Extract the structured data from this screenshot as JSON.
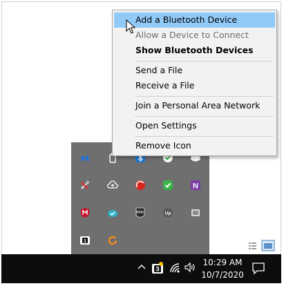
{
  "context_menu": {
    "items": [
      {
        "label": "Add a Bluetooth Device",
        "state": "highlighted"
      },
      {
        "label": "Allow a Device to Connect",
        "state": "disabled"
      },
      {
        "label": "Show Bluetooth Devices",
        "state": "default-bold"
      },
      {
        "label": "Send a File",
        "state": "normal"
      },
      {
        "label": "Receive a File",
        "state": "normal"
      },
      {
        "label": "Join a Personal Area Network",
        "state": "normal"
      },
      {
        "label": "Open Settings",
        "state": "normal"
      },
      {
        "label": "Remove Icon",
        "state": "normal"
      }
    ]
  },
  "tray_flyout": {
    "icons": [
      "malwarebytes-icon",
      "usb-drive-icon",
      "bluetooth-icon",
      "shield-check-icon",
      "cloud-icon",
      "tools-icon",
      "cloud-upload-icon",
      "antivirus-icon",
      "check-icon",
      "onenote-icon",
      "mcafee-icon",
      "cloud-check-icon",
      "epic-games-icon",
      "upwork-icon",
      "network-icon",
      "notification-badge-icon",
      "sync-icon"
    ],
    "badge_number": "1",
    "epic_text": "EPIC",
    "upwork_text": "Up",
    "onenote_letter": "N"
  },
  "taskbar": {
    "time": "10:29 AM",
    "date": "10/7/2020",
    "badge_number": "3"
  },
  "colors": {
    "menu_highlight": "#91c9f7",
    "tray_background": "#6f6f6f",
    "taskbar_background": "#0d0d0d",
    "bluetooth_blue": "#1976d2",
    "check_green": "#3bb54a",
    "mcafee_red": "#c8102e",
    "teal": "#2bb5c9",
    "sync_orange": "#f18a1b",
    "onenote_purple": "#7a3ea6"
  }
}
